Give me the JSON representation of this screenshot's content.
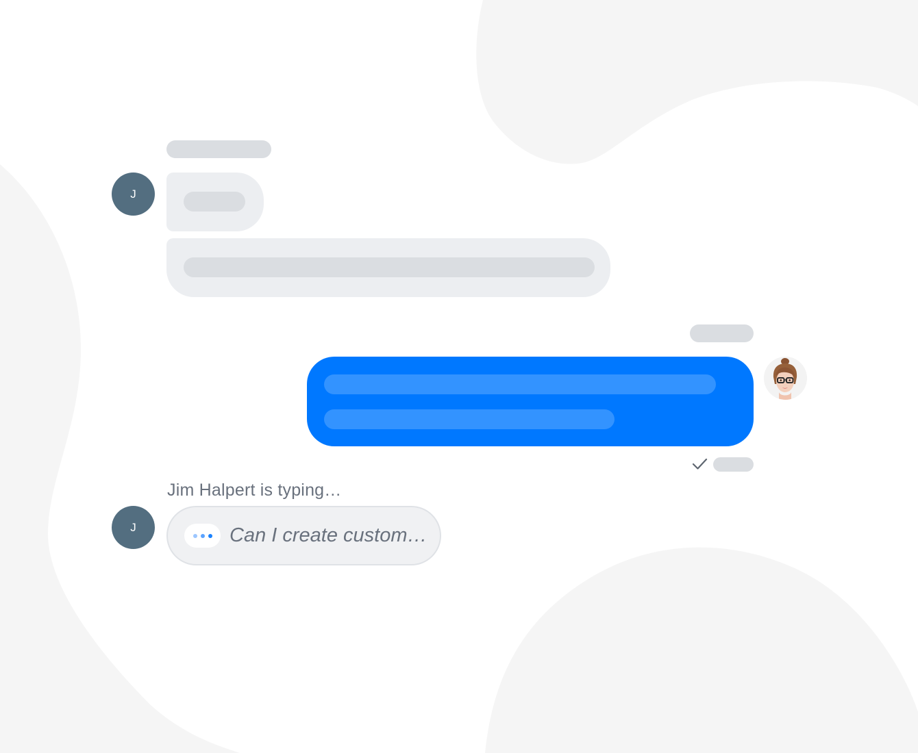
{
  "colors": {
    "background": "#ffffff",
    "blob": "#f5f5f5",
    "placeholder": "#dadde1",
    "incoming_bubble": "#eceef1",
    "outgoing_bubble": "#0078ff",
    "outgoing_placeholder": "#3393ff",
    "avatar": "#536e80",
    "muted_text": "#69717d",
    "dot_light": "#9cc6ff",
    "dot_dark": "#1a82ff"
  },
  "incoming_group": {
    "avatar_initial": "J"
  },
  "outgoing_group": {
    "avatar_icon": "agent-photo-icon",
    "status_icon": "check-icon"
  },
  "typing": {
    "label": "Jim Halpert is typing…",
    "avatar_initial": "J",
    "preview_text": "Can I create custom…",
    "indicator_icon": "typing-dots-icon"
  }
}
